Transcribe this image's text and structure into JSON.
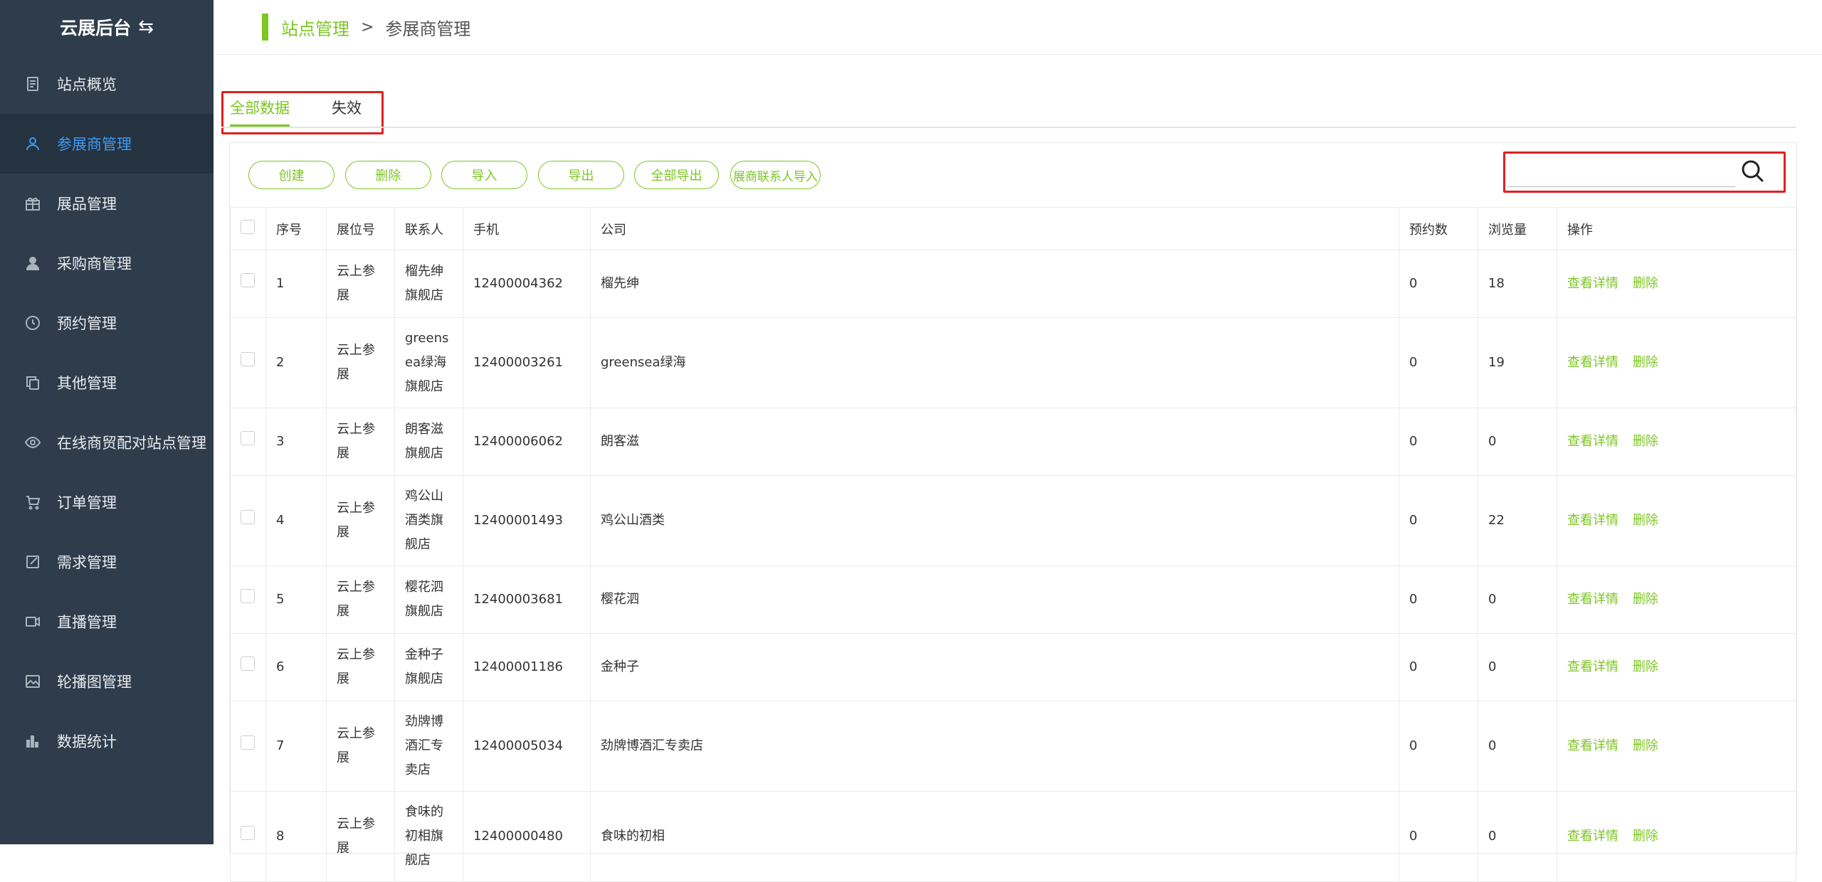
{
  "brand": {
    "title": "云展后台",
    "swap_glyph": "⇆"
  },
  "sidebar": {
    "items": [
      {
        "label": "站点概览",
        "icon": "document-icon"
      },
      {
        "label": "参展商管理",
        "icon": "user-outline-icon",
        "active": true
      },
      {
        "label": "展品管理",
        "icon": "gift-icon"
      },
      {
        "label": "采购商管理",
        "icon": "user-filled-icon"
      },
      {
        "label": "预约管理",
        "icon": "clock-icon"
      },
      {
        "label": "其他管理",
        "icon": "copy-icon"
      },
      {
        "label": "在线商贸配对站点管理",
        "icon": "eye-icon"
      },
      {
        "label": "订单管理",
        "icon": "cart-icon"
      },
      {
        "label": "需求管理",
        "icon": "edit-icon"
      },
      {
        "label": "直播管理",
        "icon": "video-icon"
      },
      {
        "label": "轮播图管理",
        "icon": "image-icon"
      },
      {
        "label": "数据统计",
        "icon": "bar-chart-icon"
      }
    ]
  },
  "header": {
    "breadcrumb_root": "站点管理",
    "separator": ">",
    "breadcrumb_page": "参展商管理"
  },
  "tabs": [
    {
      "label": "全部数据",
      "active": true
    },
    {
      "label": "失效"
    }
  ],
  "toolbar": {
    "buttons": [
      "创建",
      "删除",
      "导入",
      "导出",
      "全部导出",
      "展商联系人导入"
    ]
  },
  "search": {
    "placeholder": ""
  },
  "table": {
    "columns": [
      "",
      "序号",
      "展位号",
      "联系人",
      "手机",
      "公司",
      "预约数",
      "浏览量",
      "操作"
    ],
    "rows": [
      {
        "no": "1",
        "booth": "云上参展",
        "contact": "榴先绅旗舰店",
        "phone": "12400004362",
        "company": "榴先绅",
        "bookings": "0",
        "views": "18"
      },
      {
        "no": "2",
        "booth": "云上参展",
        "contact": "greensea绿海旗舰店",
        "phone": "12400003261",
        "company": "greensea绿海",
        "bookings": "0",
        "views": "19"
      },
      {
        "no": "3",
        "booth": "云上参展",
        "contact": "朗客滋旗舰店",
        "phone": "12400006062",
        "company": "朗客滋",
        "bookings": "0",
        "views": "0"
      },
      {
        "no": "4",
        "booth": "云上参展",
        "contact": "鸡公山酒类旗舰店",
        "phone": "12400001493",
        "company": "鸡公山酒类",
        "bookings": "0",
        "views": "22"
      },
      {
        "no": "5",
        "booth": "云上参展",
        "contact": "樱花泗旗舰店",
        "phone": "12400003681",
        "company": "樱花泗",
        "bookings": "0",
        "views": "0"
      },
      {
        "no": "6",
        "booth": "云上参展",
        "contact": "金种子旗舰店",
        "phone": "12400001186",
        "company": "金种子",
        "bookings": "0",
        "views": "0"
      },
      {
        "no": "7",
        "booth": "云上参展",
        "contact": "劲牌博酒汇专卖店",
        "phone": "12400005034",
        "company": "劲牌博酒汇专卖店",
        "bookings": "0",
        "views": "0"
      },
      {
        "no": "8",
        "booth": "云上参展",
        "contact": "食味的初相旗舰店",
        "phone": "12400000480",
        "company": "食味的初相",
        "bookings": "0",
        "views": "0"
      }
    ],
    "action_view": "查看详情",
    "action_delete": "删除"
  },
  "colors": {
    "accent": "#7dc623",
    "sidebar_bg": "#2f3c4b",
    "active_blue": "#3d9cf5",
    "highlight_red": "#e02020"
  }
}
